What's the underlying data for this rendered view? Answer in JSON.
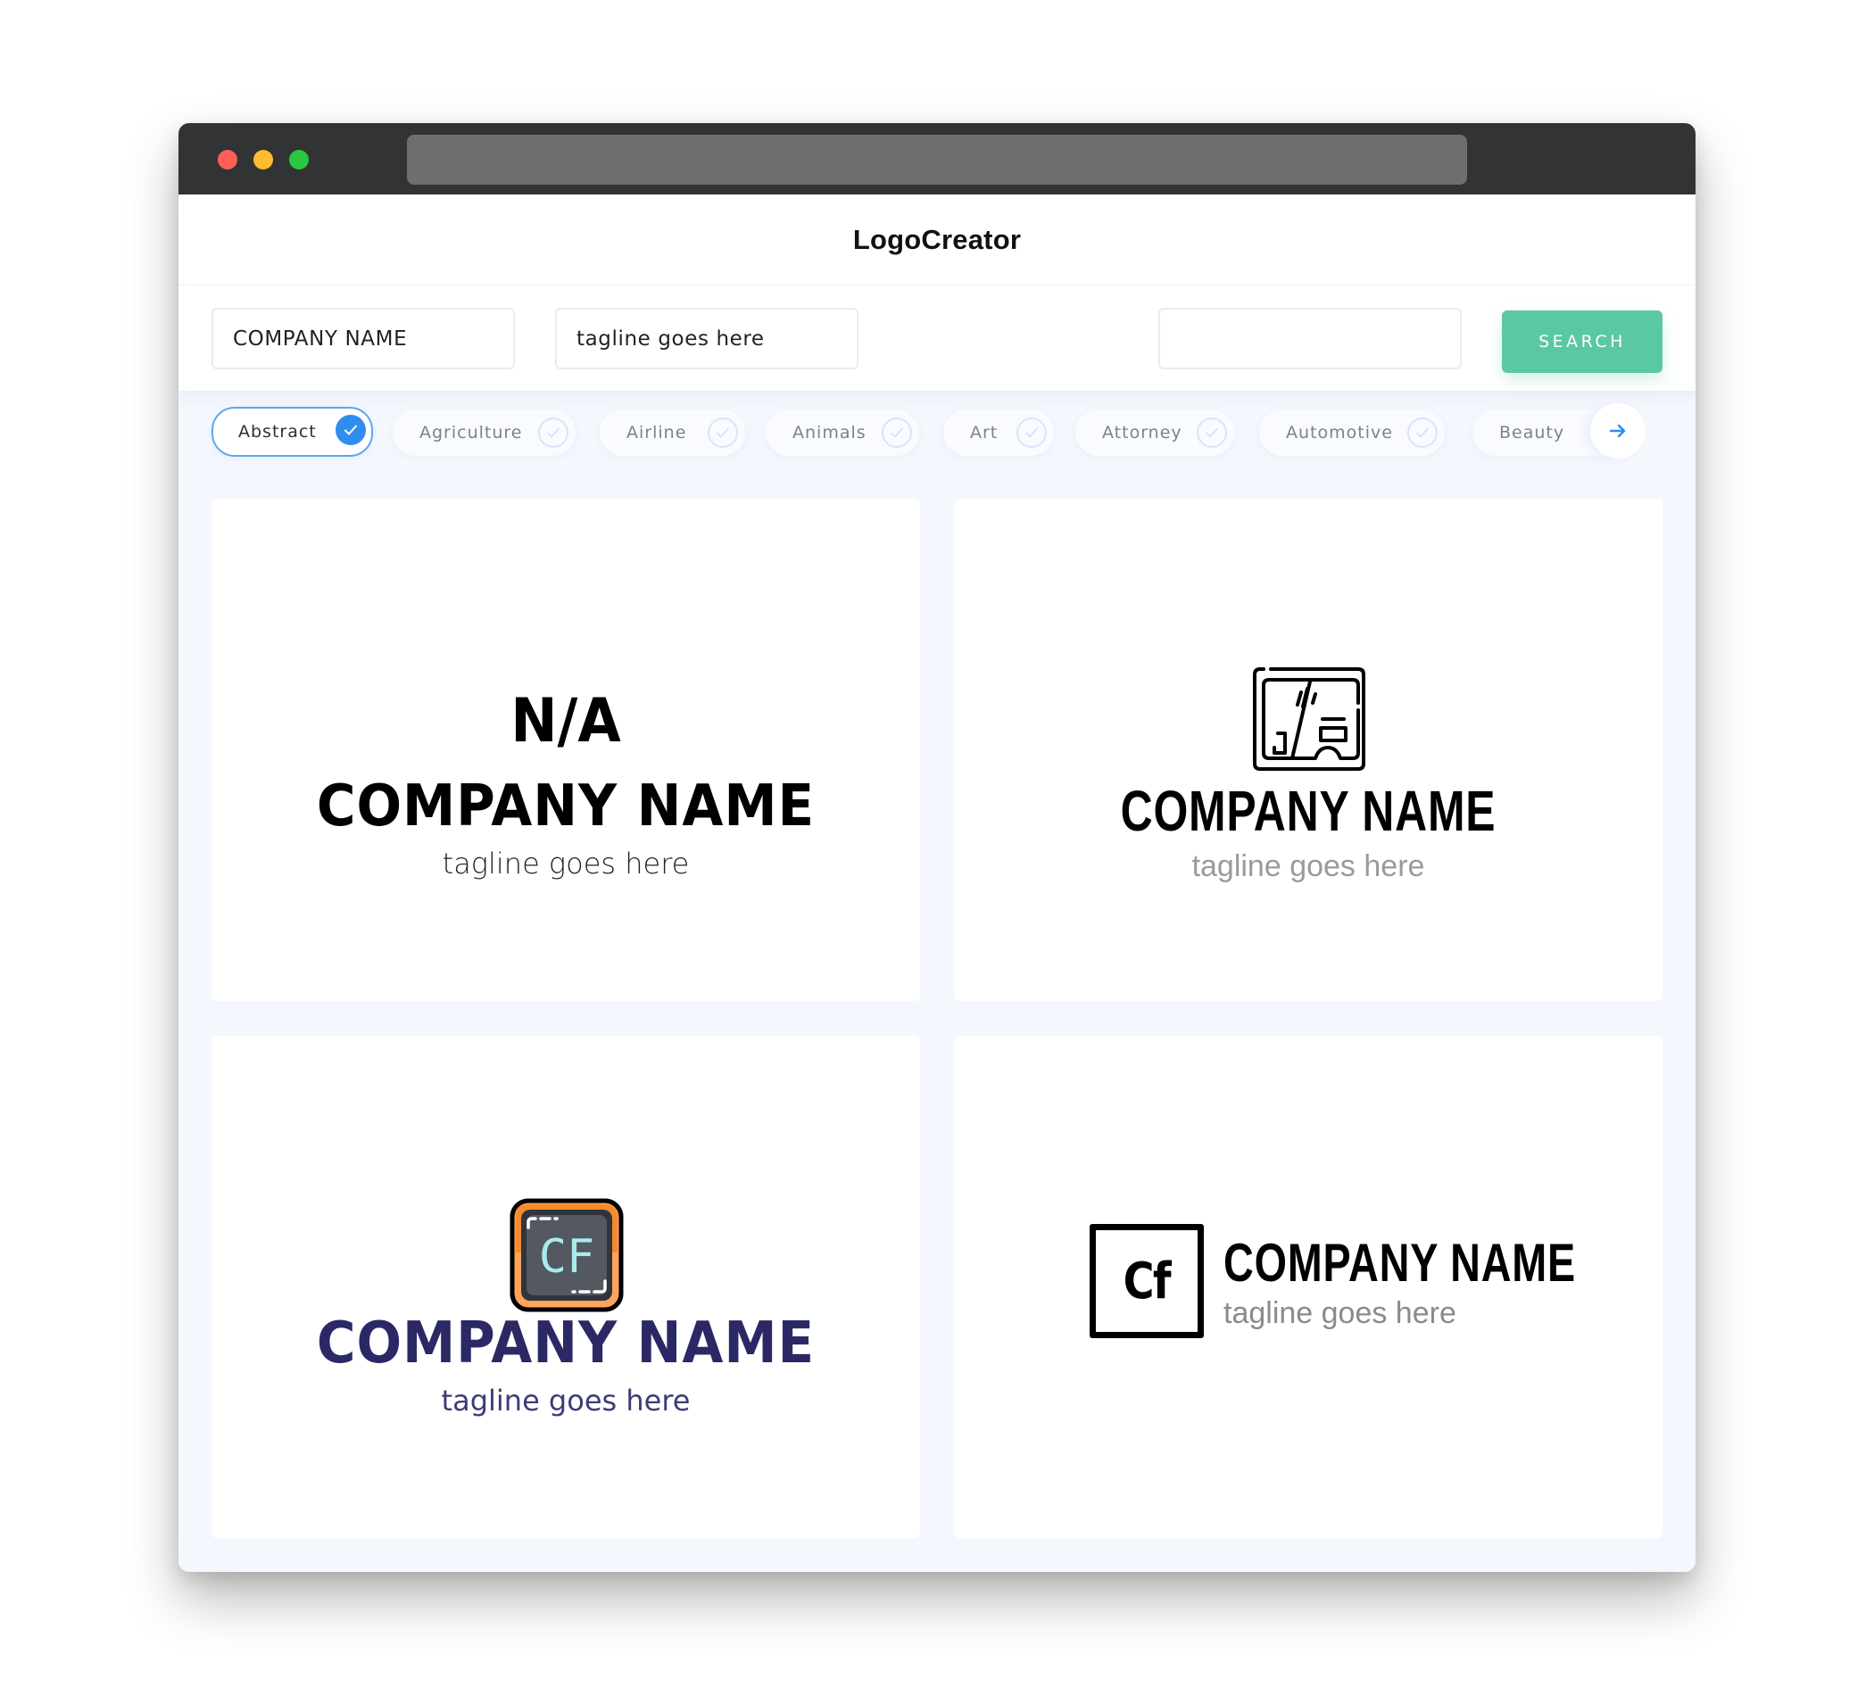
{
  "window": {
    "traffic_lights": [
      "close",
      "minimize",
      "maximize"
    ],
    "colors": {
      "close": "#fe5f57",
      "minimize": "#febc2e",
      "maximize": "#28c840"
    }
  },
  "header": {
    "title": "LogoCreator"
  },
  "search": {
    "company_value": "COMPANY NAME",
    "tagline_value": "tagline goes here",
    "extra_value": "",
    "button_label": "SEARCH",
    "button_color": "#5ac8a0"
  },
  "categories": {
    "items": [
      {
        "label": "Abstract",
        "selected": true
      },
      {
        "label": "Agriculture",
        "selected": false
      },
      {
        "label": "Airline",
        "selected": false
      },
      {
        "label": "Animals",
        "selected": false
      },
      {
        "label": "Art",
        "selected": false
      },
      {
        "label": "Attorney",
        "selected": false
      },
      {
        "label": "Automotive",
        "selected": false
      },
      {
        "label": "Beauty",
        "selected": false
      }
    ],
    "next_icon": "arrow-right-icon",
    "accent": "#2f8def"
  },
  "logos": [
    {
      "monogram": "N/A",
      "company": "COMPANY NAME",
      "tagline": "tagline goes here",
      "color": "#000000"
    },
    {
      "icon": "tablet-screen-icon",
      "company": "COMPANY NAME",
      "tagline": "tagline goes here",
      "color": "#000000"
    },
    {
      "icon": "cf-screen-icon",
      "icon_text": "CF",
      "company": "COMPANY NAME",
      "tagline": "tagline goes here",
      "color": "#2a2965"
    },
    {
      "monogram": "Cf",
      "company": "COMPANY NAME",
      "tagline": "tagline goes here",
      "color": "#000000"
    }
  ]
}
